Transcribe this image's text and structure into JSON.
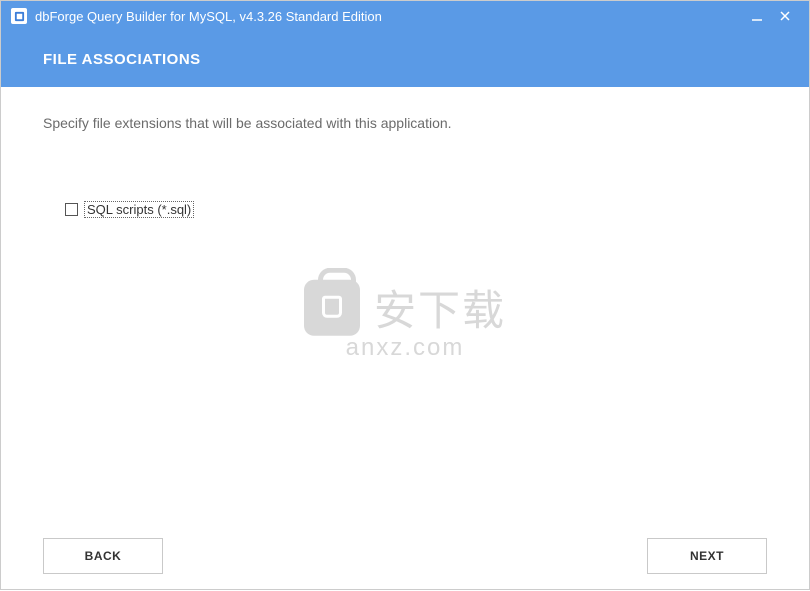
{
  "titlebar": {
    "title": "dbForge Query Builder for MySQL, v4.3.26 Standard Edition"
  },
  "header": {
    "heading": "FILE ASSOCIATIONS"
  },
  "content": {
    "instruction": "Specify file extensions that will be associated with this application.",
    "options": [
      {
        "label": "SQL scripts (*.sql)",
        "checked": false
      }
    ]
  },
  "watermark": {
    "line1": "安下载",
    "line2": "anxz.com"
  },
  "footer": {
    "back_label": "BACK",
    "next_label": "NEXT"
  }
}
